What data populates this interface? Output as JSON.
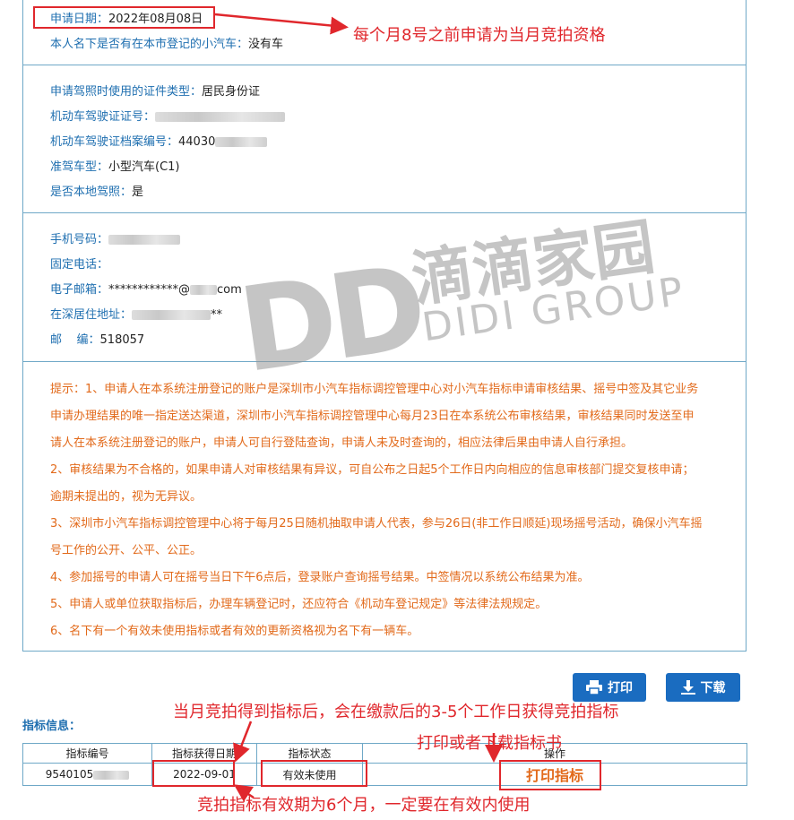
{
  "applicant": {
    "apply_date_label": "申请日期：",
    "apply_date_value": "2022年08月08日",
    "car_label": "本人名下是否有在本市登记的小汽车：",
    "car_value": "没有车"
  },
  "license": {
    "id_type_label": "申请驾照时使用的证件类型：",
    "id_type_value": "居民身份证",
    "license_no_label": "机动车驾驶证证号：",
    "file_no_label": "机动车驾驶证档案编号：",
    "file_no_value": "44030",
    "class_label": "准驾车型：",
    "class_value": "小型汽车(C1)",
    "local_label": "是否本地驾照：",
    "local_value": "是"
  },
  "contact": {
    "mobile_label": "手机号码：",
    "phone_label": "固定电话：",
    "email_label": "电子邮箱：",
    "email_prefix": "************@",
    "email_suffix": "com",
    "address_label": "在深居住地址：",
    "address_suffix": "**",
    "zip_label": "邮    编：",
    "zip_value": "518057"
  },
  "tips": [
    "提示：1、申请人在本系统注册登记的账户是深圳市小汽车指标调控管理中心对小汽车指标申请审核结果、摇号中签及其它业务",
    "申请办理结果的唯一指定送达渠道，深圳市小汽车指标调控管理中心每月23日在本系统公布审核结果，审核结果同时发送至申",
    "请人在本系统注册登记的账户，申请人可自行登陆查询，申请人未及时查询的，相应法律后果由申请人自行承担。",
    "2、审核结果为不合格的，如果申请人对审核结果有异议，可自公布之日起5个工作日内向相应的信息审核部门提交复核申请；",
    "逾期未提出的，视为无异议。",
    "3、深圳市小汽车指标调控管理中心将于每月25日随机抽取申请人代表，参与26日(非工作日顺延)现场摇号活动，确保小汽车摇",
    "号工作的公开、公平、公正。",
    "4、参加摇号的申请人可在摇号当日下午6点后，登录账户查询摇号结果。中签情况以系统公布结果为准。",
    "5、申请人或单位获取指标后，办理车辆登记时，还应符合《机动车登记规定》等法律法规规定。",
    "6、名下有一个有效未使用指标或者有效的更新资格视为名下有一辆车。"
  ],
  "buttons": {
    "print": "打印",
    "download": "下载"
  },
  "indicator": {
    "section_title": "指标信息：",
    "columns": [
      "指标编号",
      "指标获得日期",
      "指标状态",
      "操作"
    ],
    "row": {
      "number": "9540105",
      "date": "2022-09-01",
      "status": "有效未使用",
      "action": "打印指标"
    }
  },
  "annotations": {
    "a1": "每个月8号之前申请为当月竞拍资格",
    "a2": "当月竞拍得到指标后，会在缴款后的3-5个工作日获得竞拍指标",
    "a3": "打印或者下载指标书",
    "a4": "竞拍指标有效期为6个月，一定要在有效内使用"
  },
  "watermark": {
    "logo": "DD",
    "cn": "滴滴家园",
    "en": "DIDI GROUP"
  },
  "colors": {
    "label_blue": "#1f6fb0",
    "tip_orange": "#e26a1b",
    "annotation_red": "#e0272c",
    "button_blue": "#1a6cc0",
    "border": "#6fa8c7"
  }
}
